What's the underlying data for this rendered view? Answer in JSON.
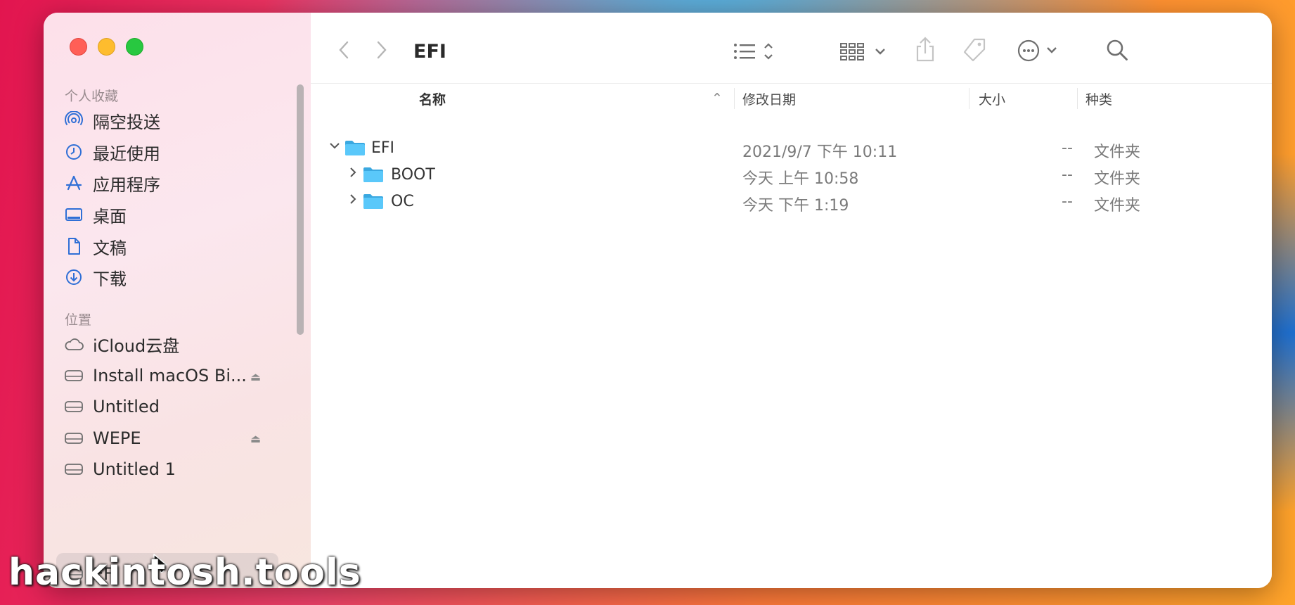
{
  "window": {
    "title": "EFI"
  },
  "sidebar": {
    "favorites_header": "个人收藏",
    "favorites": [
      {
        "label": "隔空投送",
        "icon": "airdrop-icon"
      },
      {
        "label": "最近使用",
        "icon": "clock-icon"
      },
      {
        "label": "应用程序",
        "icon": "applications-icon"
      },
      {
        "label": "桌面",
        "icon": "desktop-icon"
      },
      {
        "label": "文稿",
        "icon": "document-icon"
      },
      {
        "label": "下载",
        "icon": "download-icon"
      }
    ],
    "locations_header": "位置",
    "locations": [
      {
        "label": "iCloud云盘",
        "icon": "cloud-icon",
        "eject": false
      },
      {
        "label": "Install macOS Bi...",
        "icon": "drive-icon",
        "eject": true
      },
      {
        "label": "Untitled",
        "icon": "drive-icon",
        "eject": false
      },
      {
        "label": "WEPE",
        "icon": "drive-icon",
        "eject": true
      },
      {
        "label": "Untitled 1",
        "icon": "drive-icon",
        "eject": false
      },
      {
        "label": "EFI",
        "icon": "drive-icon",
        "eject": false,
        "selected": true
      }
    ],
    "eject_glyph": "⏏"
  },
  "toolbar": {
    "back_icon": "chevron-left-icon",
    "forward_icon": "chevron-right-icon",
    "view_icon": "list-view-icon",
    "group_icon": "grid-group-icon",
    "share_icon": "share-icon",
    "tag_icon": "tag-icon",
    "more_icon": "ellipsis-circle-icon",
    "search_icon": "search-icon"
  },
  "columns": {
    "name": "名称",
    "modified": "修改日期",
    "size": "大小",
    "kind": "种类",
    "sort_glyph": "⌃"
  },
  "files": [
    {
      "name": "EFI",
      "modified": "2021/9/7 下午 10:11",
      "size": "--",
      "kind": "文件夹",
      "expanded": true,
      "depth": 0
    },
    {
      "name": "BOOT",
      "modified": "今天 上午 10:58",
      "size": "--",
      "kind": "文件夹",
      "expanded": false,
      "depth": 1
    },
    {
      "name": "OC",
      "modified": "今天 下午 1:19",
      "size": "--",
      "kind": "文件夹",
      "expanded": false,
      "depth": 1
    }
  ],
  "watermark": "hackintosh.tools",
  "colors": {
    "folder": "#5ac8fa",
    "folder_dark": "#3aa8e0",
    "accent": "#2a2a2a"
  }
}
